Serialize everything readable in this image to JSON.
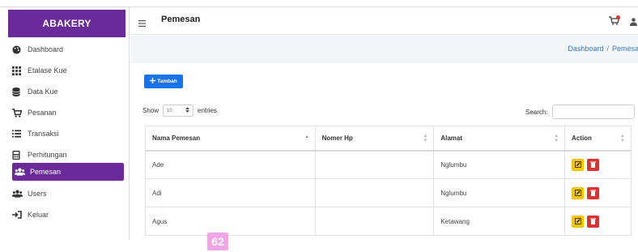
{
  "app": {
    "brand": "ABAKERY"
  },
  "sidebar": {
    "items": [
      {
        "label": "Dashboard",
        "icon": "palette-icon"
      },
      {
        "label": "Etalase Kue",
        "icon": "grid-icon"
      },
      {
        "label": "Data Kue",
        "icon": "database-icon"
      },
      {
        "label": "Pesanan",
        "icon": "cart-icon"
      },
      {
        "label": "Transaksi",
        "icon": "list-icon"
      },
      {
        "label": "Perhitungan",
        "icon": "calculator-icon"
      },
      {
        "label": "Pemesan",
        "icon": "users-icon",
        "active": true
      },
      {
        "label": "Users",
        "icon": "users-icon"
      },
      {
        "label": "Keluar",
        "icon": "logout-icon"
      }
    ]
  },
  "header": {
    "title": "Pemesan"
  },
  "breadcrumb": {
    "home": "Dashboard",
    "separator": "/",
    "current": "Pemesan"
  },
  "toolbar": {
    "add_label": "Tambah"
  },
  "table_controls": {
    "show_label": "Show",
    "entries_value": "10",
    "entries_label": "entries",
    "search_label": "Search:"
  },
  "table": {
    "headers": [
      "Nama Pemesan",
      "Nomer Hp",
      "Alamat",
      "Action"
    ],
    "rows": [
      {
        "nama": "Ade",
        "hp": "",
        "alamat": "Nglumbu"
      },
      {
        "nama": "Adi",
        "hp": "",
        "alamat": "Nglumbu"
      },
      {
        "nama": "Agus",
        "hp": "",
        "alamat": "Ketawang"
      }
    ]
  },
  "page_badge": "62",
  "colors": {
    "accent": "#6a2a9a",
    "primary": "#1a73e8",
    "edit": "#f7c400",
    "delete": "#e03131",
    "link": "#3b7ddd"
  }
}
